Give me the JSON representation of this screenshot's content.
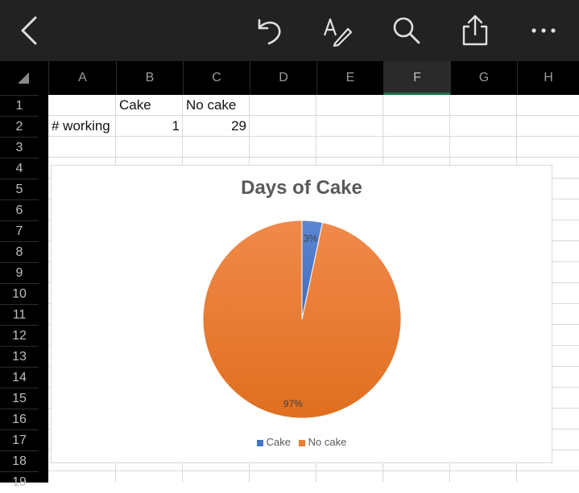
{
  "toolbar": {
    "icons": [
      "back-icon",
      "undo-icon",
      "draw-icon",
      "search-icon",
      "share-icon",
      "more-icon"
    ]
  },
  "sheet": {
    "columns": [
      "A",
      "B",
      "C",
      "D",
      "E",
      "F",
      "G",
      "H"
    ],
    "selected_column": "F",
    "rows": [
      "1",
      "2",
      "3",
      "4",
      "5",
      "6",
      "7",
      "8",
      "9",
      "10",
      "11",
      "12",
      "13",
      "14",
      "15",
      "16",
      "17",
      "18",
      "19"
    ],
    "cells": {
      "B1": "Cake",
      "C1": "No cake",
      "A2": "# working",
      "B2": "1",
      "C2": "29"
    }
  },
  "chart_data": {
    "type": "pie",
    "title": "Days of Cake",
    "categories": [
      "Cake",
      "No cake"
    ],
    "values": [
      1,
      29
    ],
    "data_labels": [
      "3%",
      "97%"
    ],
    "colors": [
      "#4472c4",
      "#ed7d31"
    ],
    "legend_position": "bottom"
  }
}
